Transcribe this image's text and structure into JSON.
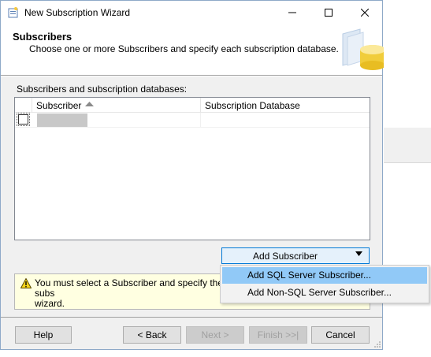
{
  "window": {
    "title": "New Subscription Wizard"
  },
  "header": {
    "title": "Subscribers",
    "subtitle": "Choose one or more Subscribers and specify each subscription database."
  },
  "list": {
    "label": "Subscribers and subscription databases:",
    "columns": [
      "Subscriber",
      "Subscription Database"
    ],
    "rows": [
      {
        "checked": false,
        "subscriber": "",
        "database": ""
      }
    ]
  },
  "add_button": {
    "label": "Add Subscriber"
  },
  "dropdown_menu": {
    "items": [
      {
        "label": "Add SQL Server Subscriber...",
        "highlighted": true
      },
      {
        "label": "Add Non-SQL Server Subscriber...",
        "highlighted": false
      }
    ]
  },
  "warning": {
    "text": "You must select a Subscriber and specify the subs\nwizard."
  },
  "buttons": {
    "help": "Help",
    "back": "< Back",
    "next": "Next >",
    "finish": "Finish >>|",
    "cancel": "Cancel"
  },
  "colors": {
    "accent": "#0078d7",
    "highlight": "#91c9f7",
    "warning_bg": "#ffffe1"
  }
}
